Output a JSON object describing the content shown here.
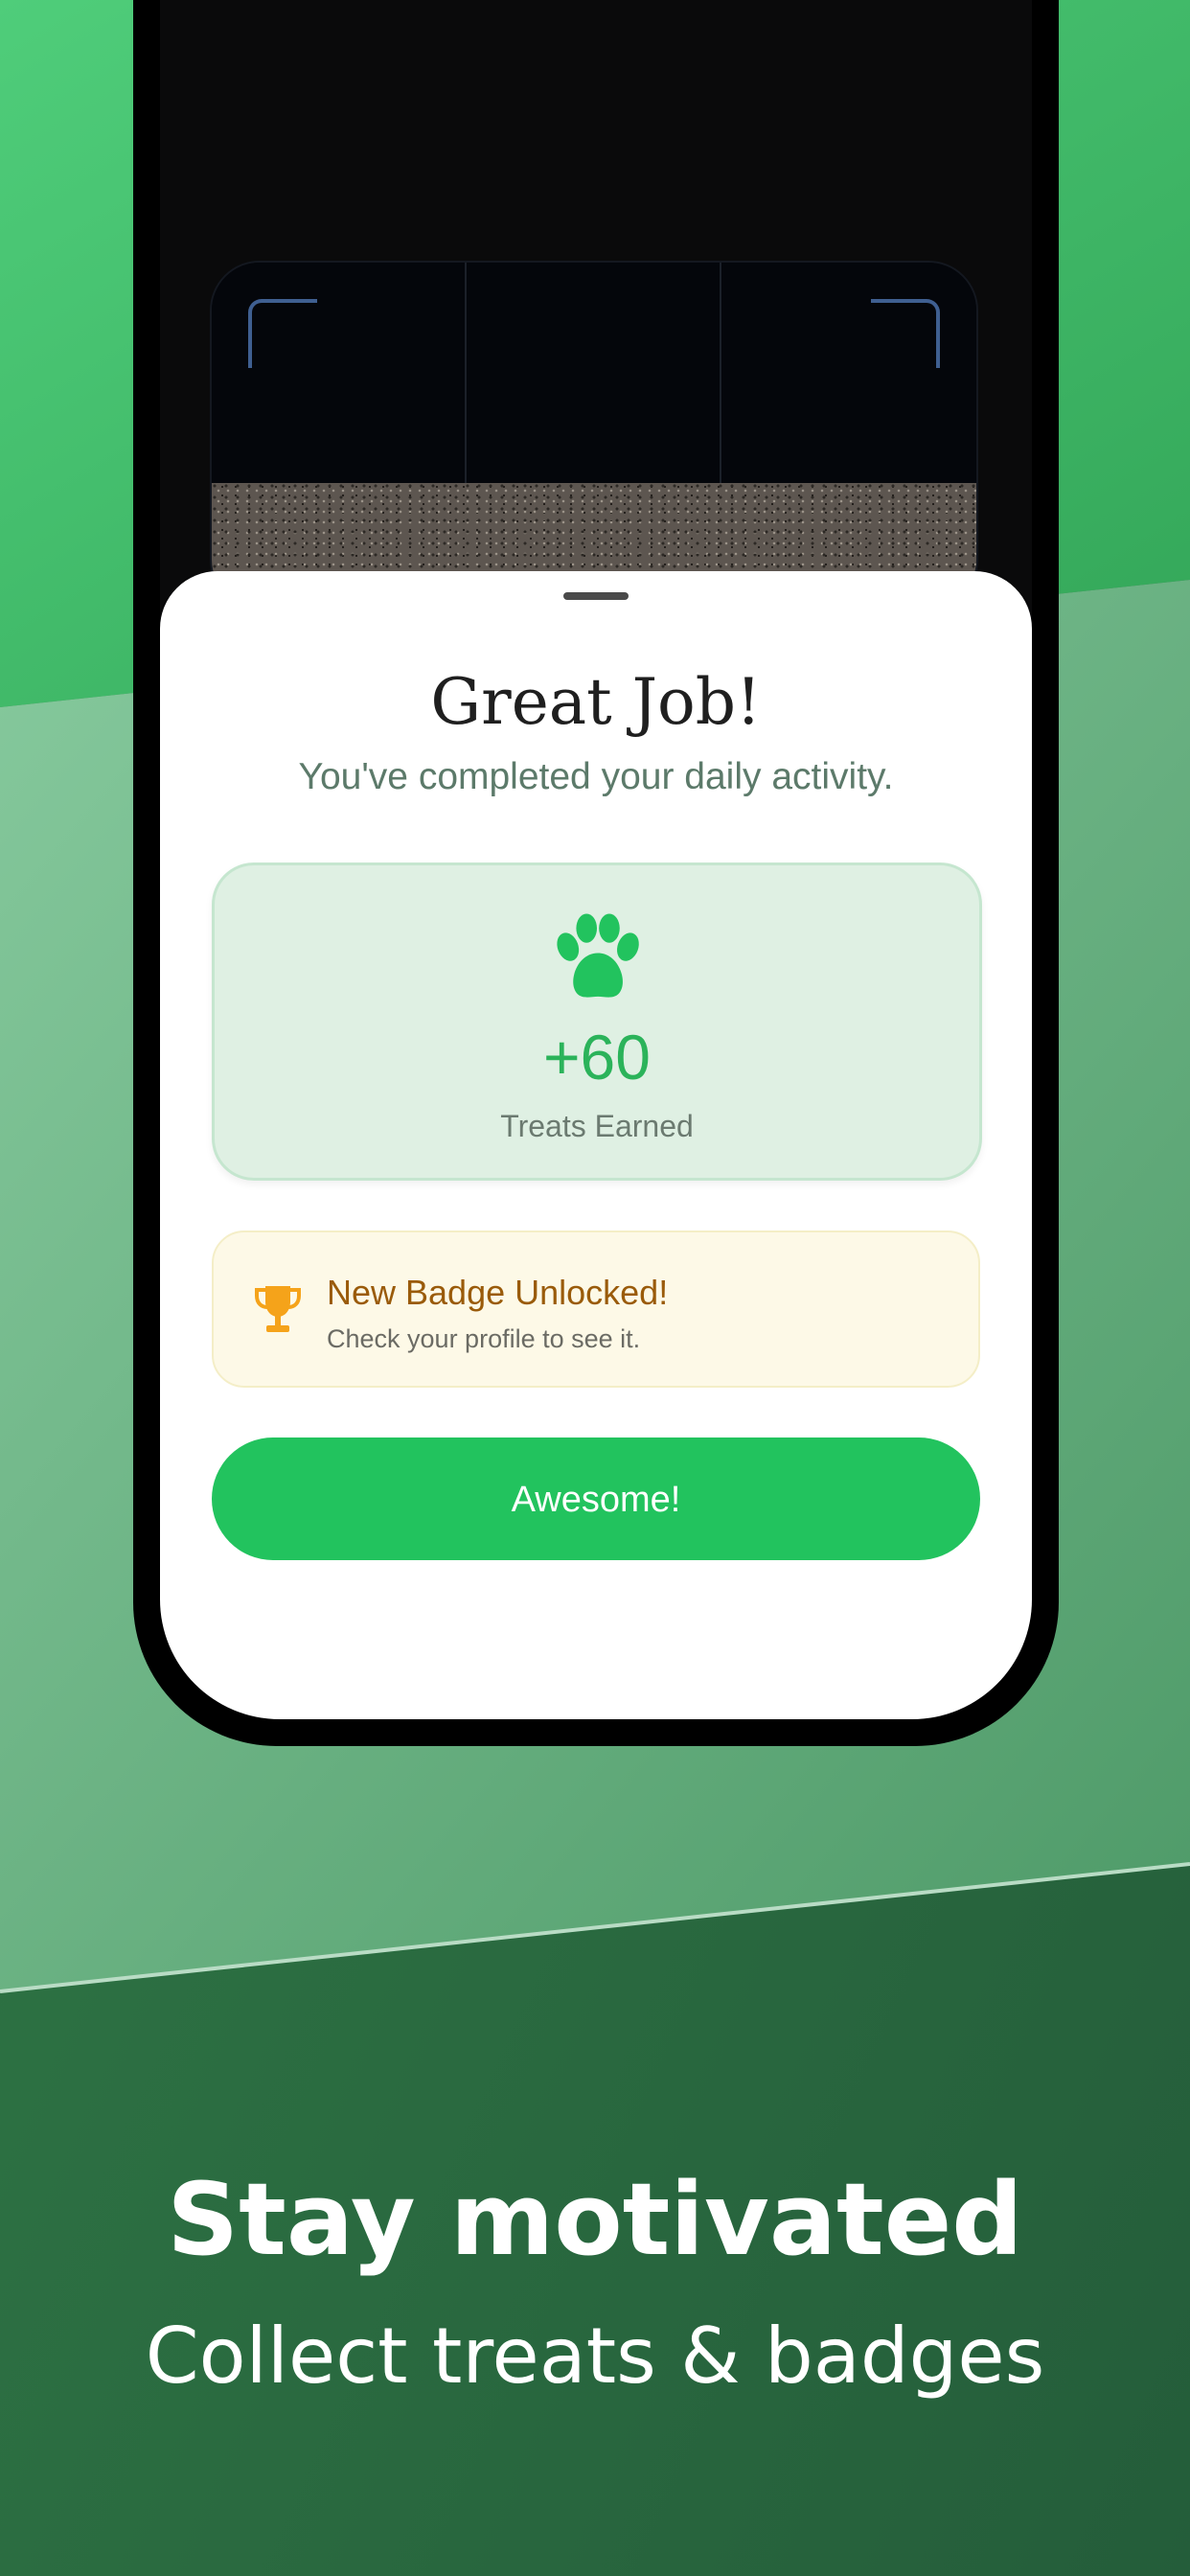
{
  "colors": {
    "accent": "#22c35e",
    "treats_value": "#2bb35a",
    "badge_title": "#9a5b0a",
    "trophy": "#f5a31a"
  },
  "modal": {
    "title": "Great Job!",
    "subtitle": "You've completed your daily activity.",
    "treats": {
      "icon": "paw-icon",
      "value": "+60",
      "label": "Treats Earned"
    },
    "badge": {
      "icon": "trophy-icon",
      "title": "New Badge Unlocked!",
      "subtitle": "Check your profile to see it."
    },
    "button_label": "Awesome!"
  },
  "promo": {
    "headline": "Stay motivated",
    "tagline": "Collect treats & badges"
  }
}
